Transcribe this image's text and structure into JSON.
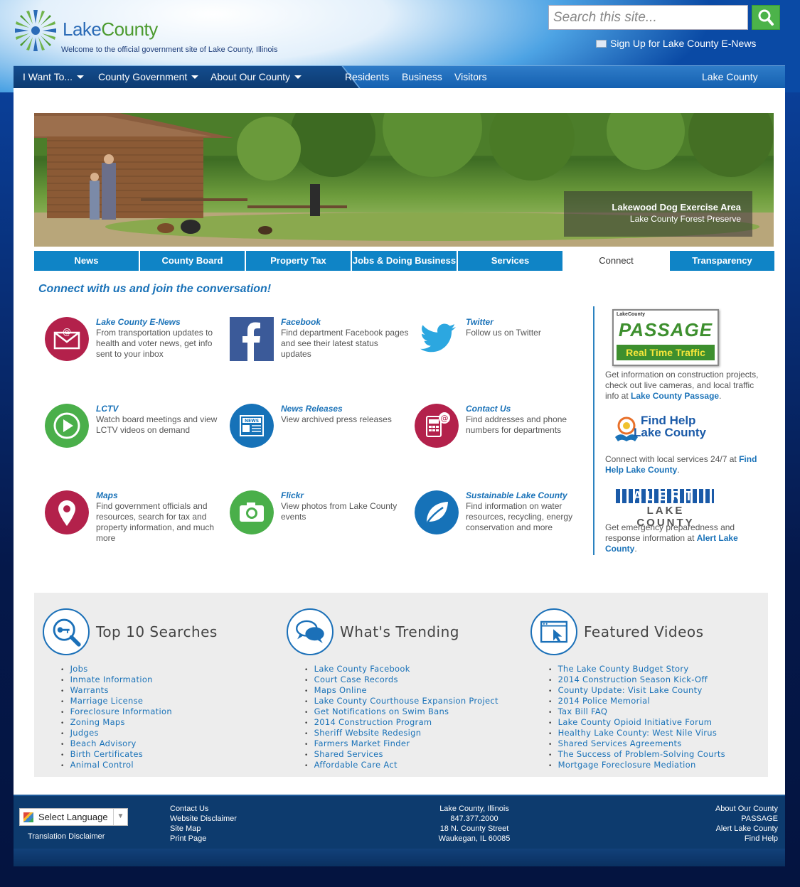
{
  "header": {
    "logo_text_1": "Lake",
    "logo_text_2": "County",
    "tagline": "Welcome to the official government site of Lake County, Illinois",
    "search_placeholder": "Search this site...",
    "enews_label": "Sign Up for Lake County E-News"
  },
  "nav": {
    "i_want_to": "I Want To...",
    "county_government": "County Government",
    "about": "About Our County",
    "residents": "Residents",
    "business": "Business",
    "visitors": "Visitors",
    "lake_county": "Lake County"
  },
  "banner": {
    "title": "Lakewood Dog Exercise Area",
    "subtitle": "Lake County Forest Preserve"
  },
  "tabs": [
    "News",
    "County Board",
    "Property Tax",
    "Jobs & Doing Business",
    "Services",
    "Connect",
    "Transparency"
  ],
  "active_tab": "Connect",
  "connect": {
    "heading": "Connect with us and join the conversation!",
    "items": [
      {
        "title": "Lake County E-News",
        "desc": "From transportation updates to health and voter news, get info sent to your inbox",
        "icon": "envelope-icon"
      },
      {
        "title": "Facebook",
        "desc": "Find department Facebook pages and see their latest status updates",
        "icon": "facebook-icon"
      },
      {
        "title": "Twitter",
        "desc": "Follow us on Twitter",
        "icon": "twitter-bird-icon"
      },
      {
        "title": "LCTV",
        "desc": "Watch board meetings and view LCTV videos on demand",
        "icon": "play-icon"
      },
      {
        "title": "News Releases",
        "desc": "View archived press releases",
        "icon": "newspaper-icon"
      },
      {
        "title": "Contact Us",
        "desc": "Find addresses and phone numbers for departments",
        "icon": "phone-directory-icon"
      },
      {
        "title": "Maps",
        "desc": "Find government officials and resources, search for tax and property information, and much more",
        "icon": "map-pin-icon"
      },
      {
        "title": "Flickr",
        "desc": "View photos from Lake County events",
        "icon": "camera-icon"
      },
      {
        "title": "Sustainable Lake County",
        "desc": "Find information on water resources, recycling, energy conservation and more",
        "icon": "leaf-icon"
      }
    ]
  },
  "sidebar": {
    "passage_logo_top": "LakeCounty",
    "passage_logo_main": "PASSAGE",
    "passage_logo_sub": "Real Time Traffic",
    "passage_text": "Get information on construction projects, check out live cameras, and local traffic info at ",
    "passage_link": "Lake County Passage",
    "findhelp_logo_1": "Find Help",
    "findhelp_logo_2": "Lake County",
    "findhelp_text": "Connect with local services 24/7 at ",
    "findhelp_link": "Find Help Lake County",
    "alert_logo_1": "ALERT",
    "alert_logo_2": "LAKE COUNTY",
    "alert_text": "Get emergency preparedness and response information at ",
    "alert_link": "Alert Lake County",
    "period": "."
  },
  "lists": {
    "top10": {
      "title": "Top 10 Searches",
      "items": [
        "Jobs",
        "Inmate Information",
        "Warrants",
        "Marriage License",
        "Foreclosure Information",
        "Zoning Maps",
        "Judges",
        "Beach Advisory",
        "Birth Certificates",
        "Animal Control"
      ]
    },
    "trending": {
      "title": "What's Trending",
      "items": [
        "Lake County Facebook",
        "Court Case Records",
        "Maps Online",
        "Lake County Courthouse Expansion Project",
        "Get Notifications on Swim Bans",
        "2014 Construction Program",
        "Sheriff Website Redesign",
        "Farmers Market Finder",
        "Shared Services",
        "Affordable Care Act"
      ]
    },
    "videos": {
      "title": "Featured Videos",
      "items": [
        "The Lake County Budget Story",
        "2014 Construction Season Kick-Off",
        "County Update: Visit Lake County",
        "2014 Police Memorial",
        "Tax Bill FAQ",
        "Lake County Opioid Initiative Forum",
        "Healthy Lake County: West Nile Virus",
        "Shared Services Agreements",
        "The Success of Problem-Solving Courts",
        "Mortgage Foreclosure Mediation"
      ]
    }
  },
  "footer": {
    "select_language": "Select Language",
    "translation_disclaimer": "Translation Disclaimer",
    "links": [
      "Contact Us",
      "Website Disclaimer",
      "Site Map",
      "Print Page"
    ],
    "address": [
      "Lake County, Illinois",
      "847.377.2000",
      "18 N. County Street",
      "Waukegan, IL 60085"
    ],
    "right_links": [
      "About Our County",
      "PASSAGE",
      "Alert Lake County",
      "Find Help"
    ]
  }
}
